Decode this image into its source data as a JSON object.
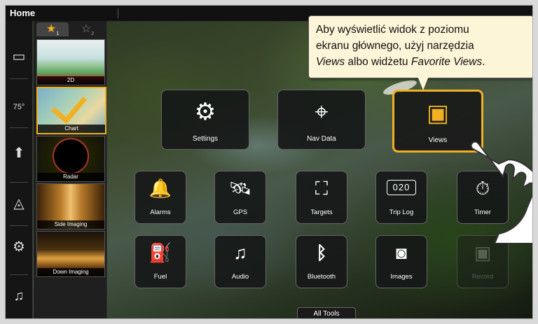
{
  "topbar": {
    "title": "Home"
  },
  "favorites": {
    "tab1": {
      "icon": "star-filled-icon",
      "glyph": "★",
      "sub": "1"
    },
    "tab2": {
      "icon": "star-outline-icon",
      "glyph": "☆",
      "sub": "2"
    },
    "thumbs": [
      {
        "label": "2D"
      },
      {
        "label": "Chart"
      },
      {
        "label": "Radar"
      },
      {
        "label": "Side Imaging"
      },
      {
        "label": "Down Imaging"
      }
    ]
  },
  "rail": {
    "icons": [
      {
        "name": "views-rail-icon",
        "glyph": "▭"
      },
      {
        "name": "gauge-75-icon",
        "glyph": "75°"
      },
      {
        "name": "boat-icon",
        "glyph": "⬆"
      },
      {
        "name": "navigation-icon",
        "glyph": "◬"
      },
      {
        "name": "motor-icon",
        "glyph": "⚙"
      },
      {
        "name": "music-note-icon",
        "glyph": "♫"
      }
    ]
  },
  "tiles": {
    "settings": {
      "label": "Settings",
      "glyph": "⚙"
    },
    "nav_data": {
      "label": "Nav Data",
      "glyph": "⌖"
    },
    "views": {
      "label": "Views",
      "glyph": "▣"
    },
    "alarms": {
      "label": "Alarms",
      "glyph": "🔔"
    },
    "gps": {
      "label": "GPS",
      "glyph": "🛰"
    },
    "targets": {
      "label": "Targets",
      "glyph": "⛶"
    },
    "trip_log": {
      "label": "Trip Log",
      "glyph": "020"
    },
    "timer": {
      "label": "Timer",
      "glyph": "⏱"
    },
    "fuel": {
      "label": "Fuel",
      "glyph": "⛽"
    },
    "audio": {
      "label": "Audio",
      "glyph": "♫"
    },
    "bluetooth": {
      "label": "Bluetooth",
      "glyph": "ᛒ"
    },
    "images": {
      "label": "Images",
      "glyph": "◙"
    },
    "record": {
      "label": "Record",
      "glyph": "▣"
    }
  },
  "all_tools": {
    "label": "All Tools"
  },
  "callout": {
    "line1": "Aby wyświetlić widok z poziomu",
    "line2": "ekranu głównego, użyj narzędzia",
    "views_word": "Views",
    "mid": " albo widżetu ",
    "fav_word": "Favorite Views",
    "end": "."
  },
  "colors": {
    "accent": "#f0b020",
    "tile_bg": "#161818",
    "callout_bg": "#fdf5d8"
  }
}
